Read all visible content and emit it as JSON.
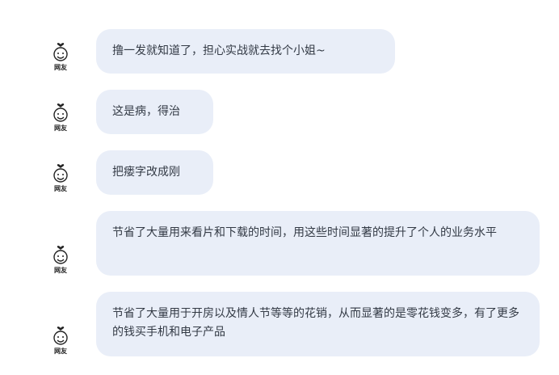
{
  "avatar_label": "网友",
  "messages": [
    {
      "text": "撸一发就知道了，担心实战就去找个小姐~"
    },
    {
      "text": "这是病，得治"
    },
    {
      "text": "把瘘字改成刚"
    },
    {
      "text": "节省了大量用来看片和下载的时间，用这些时间显著的提升了个人的业务水平"
    },
    {
      "text": "节省了大量用于开房以及情人节等等的花销，从而显著的是零花钱变多，有了更多的钱买手机和电子产品"
    }
  ]
}
